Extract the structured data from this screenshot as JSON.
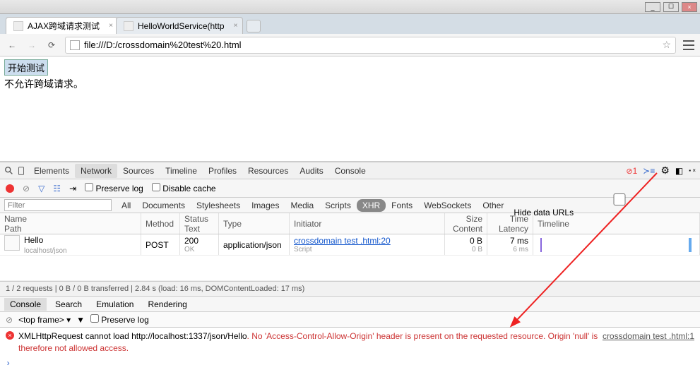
{
  "window": {
    "min": "_",
    "max": "☐",
    "close": "×"
  },
  "tabs": [
    {
      "title": "AJAX跨域请求测试",
      "active": true
    },
    {
      "title": "HelloWorldService(http",
      "active": false
    }
  ],
  "address": "file:///D:/crossdomain%20test%20.html",
  "page": {
    "button_label": "开始测试",
    "message": "不允许跨域请求。"
  },
  "devtools": {
    "panels": [
      "Elements",
      "Network",
      "Sources",
      "Timeline",
      "Profiles",
      "Resources",
      "Audits",
      "Console"
    ],
    "active_panel": "Network",
    "error_count": "1",
    "toolbar": {
      "preserve_log": "Preserve log",
      "disable_cache": "Disable cache"
    },
    "filter": {
      "placeholder": "Filter",
      "types": [
        "All",
        "Documents",
        "Stylesheets",
        "Images",
        "Media",
        "Scripts",
        "XHR",
        "Fonts",
        "WebSockets",
        "Other"
      ],
      "active": "XHR",
      "hide_data": "Hide data URLs"
    },
    "columns": {
      "name": "Name",
      "path": "Path",
      "method": "Method",
      "status": "Status",
      "text": "Text",
      "type": "Type",
      "initiator": "Initiator",
      "size": "Size",
      "content": "Content",
      "time": "Time",
      "latency": "Latency",
      "timeline": "Timeline"
    },
    "rows": [
      {
        "name": "Hello",
        "path": "localhost/json",
        "method": "POST",
        "status": "200",
        "statusText": "OK",
        "type": "application/json",
        "initiator": "crossdomain test .html:20",
        "initiatorSub": "Script",
        "size": "0 B",
        "content": "0 B",
        "time": "7 ms",
        "latency": "6 ms"
      }
    ],
    "summary": "1 / 2 requests | 0 B / 0 B transferred | 2.84 s (load: 16 ms, DOMContentLoaded: 17 ms)",
    "drawer": {
      "tabs": [
        "Console",
        "Search",
        "Emulation",
        "Rendering"
      ],
      "active": "Console",
      "frame": "<top frame>",
      "preserve": "Preserve log"
    },
    "console": {
      "prefix": "XMLHttpRequest cannot load ",
      "url": "http://localhost:1337/json/Hello",
      "error": ". No 'Access-Control-Allow-Origin' header is present on the requested resource. Origin 'null' is therefore not allowed access.",
      "source": "crossdomain test .html:1"
    }
  },
  "colors": {
    "error": "#c33",
    "link": "#15c",
    "timeline_blue": "#6ae",
    "timeline_purple": "#86d"
  }
}
